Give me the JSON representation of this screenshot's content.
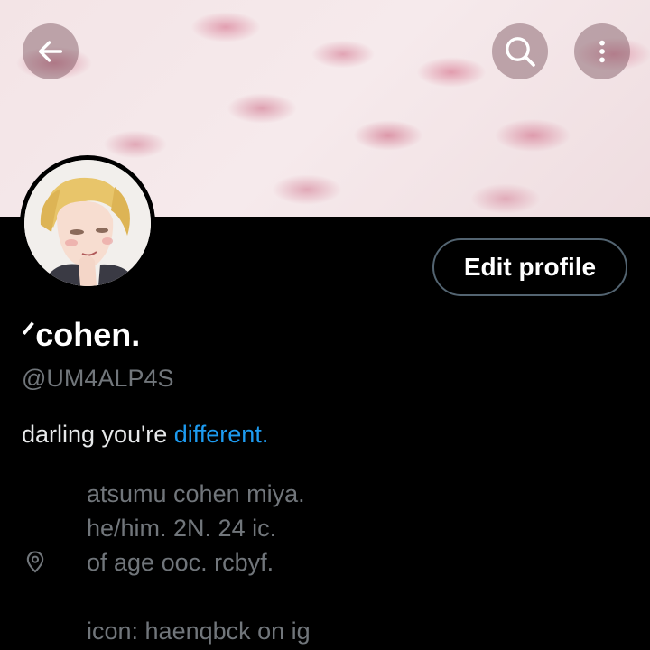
{
  "header": {
    "back_icon": "arrow-left-icon",
    "search_icon": "search-icon",
    "more_icon": "more-vertical-icon"
  },
  "profile": {
    "edit_button_label": "Edit profile",
    "display_name": "ᐟcohen.",
    "handle": "@UM4ALP4S",
    "bio_text": "darling you're ",
    "bio_link": "different.",
    "location_icon": "location-pin-icon",
    "location_lines": [
      "atsumu cohen miya.",
      "he/him. 2N. 24 ic.",
      "of age ooc. rcbyf.",
      "",
      "icon: haenqbck on ig"
    ]
  },
  "colors": {
    "link": "#1d9bf0",
    "secondary_text": "#71767b",
    "button_border": "#536471"
  }
}
